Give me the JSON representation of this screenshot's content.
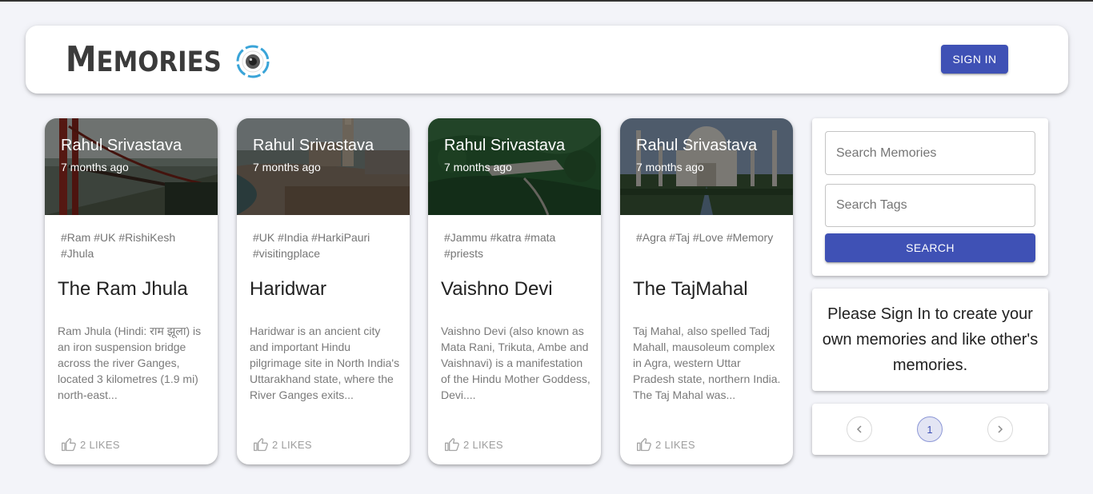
{
  "header": {
    "brand": "MEMORIES",
    "brand_first": "M",
    "brand_rest": "EMORIES",
    "signin_label": "SIGN IN"
  },
  "posts": [
    {
      "author": "Rahul Srivastava",
      "time": "7 months ago",
      "tags": "#Ram #UK #RishiKesh #Jhula",
      "title": "The Ram Jhula",
      "body": "Ram Jhula (Hindi: राम झूला) is an iron suspension bridge across the river Ganges, located 3 kilometres (1.9 mi) north-east...",
      "likes": "2 LIKES",
      "image": "suspension-bridge-photo"
    },
    {
      "author": "Rahul Srivastava",
      "time": "7 months ago",
      "tags": "#UK #India #HarkiPauri #visitingplace",
      "title": "Haridwar",
      "body": "Haridwar is an ancient city and important Hindu pilgrimage site in North India's Uttarakhand state, where the River Ganges exits...",
      "likes": "2 LIKES",
      "image": "ghat-river-photo"
    },
    {
      "author": "Rahul Srivastava",
      "time": "7 months ago",
      "tags": "#Jammu #katra #mata #priests",
      "title": "Vaishno Devi",
      "body": "Vaishno Devi (also known as Mata Rani, Trikuta, Ambe and Vaishnavi) is a manifestation of the Hindu Mother Goddess, Devi....",
      "likes": "2 LIKES",
      "image": "mountain-forest-photo"
    },
    {
      "author": "Rahul Srivastava",
      "time": "7 months ago",
      "tags": "#Agra #Taj #Love #Memory",
      "title": "The TajMahal",
      "body": "Taj Mahal, also spelled Tadj Mahall, mausoleum complex in Agra, western Uttar Pradesh state, northern India. The Taj Mahal was...",
      "likes": "2 LIKES",
      "image": "taj-mahal-photo"
    }
  ],
  "search": {
    "memories_placeholder": "Search Memories",
    "tags_placeholder": "Search Tags",
    "button_label": "SEARCH"
  },
  "notice": {
    "text": "Please Sign In to create your own memories and like other's memories."
  },
  "pagination": {
    "current_page": "1",
    "prev_icon": "chevron-left-icon",
    "next_icon": "chevron-right-icon"
  },
  "colors": {
    "primary": "#3f51b5",
    "background": "#f3f4f9",
    "logo_accent": "#3aa4d8"
  }
}
